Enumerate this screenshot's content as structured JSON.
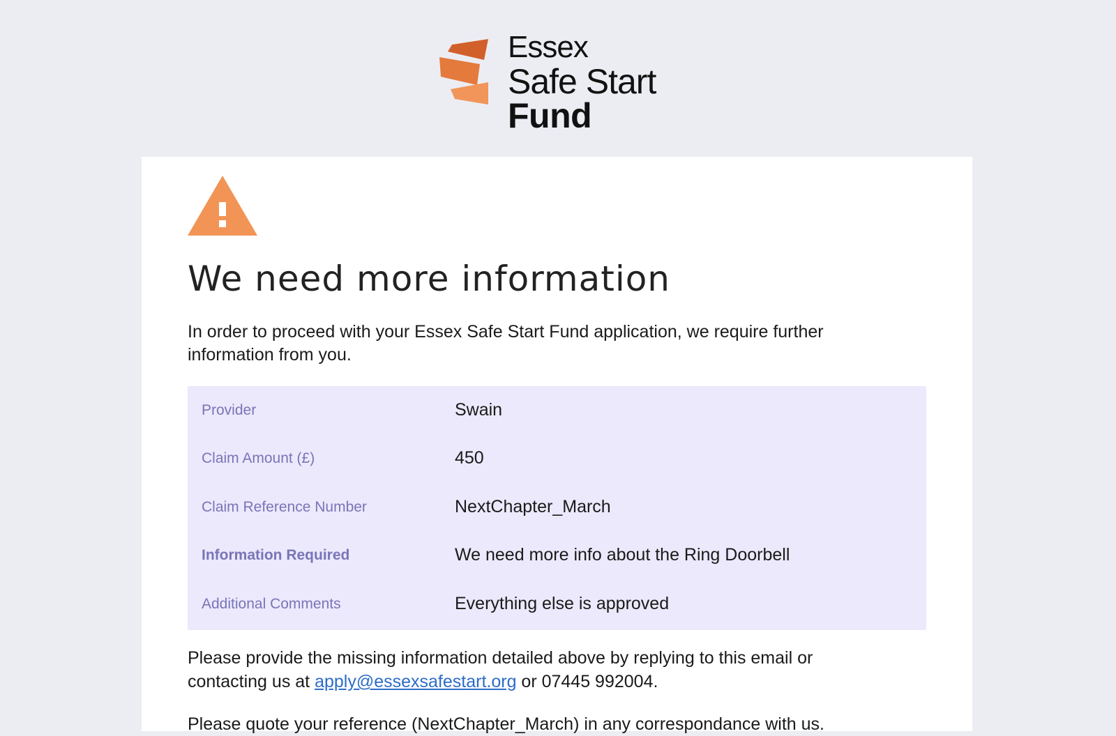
{
  "brand": {
    "line1": "Essex",
    "line2": "Safe Start",
    "line3": "Fund",
    "colors": {
      "dark_orange": "#d2602a",
      "mid_orange": "#e47a3c",
      "light_orange": "#f2955a"
    }
  },
  "alert": {
    "icon": "warning-icon",
    "icon_color": "#f29455",
    "title": "We need more information",
    "intro": "In order to proceed with your Essex Safe Start Fund application, we require further information from you."
  },
  "details": {
    "background": "#ebe9fb",
    "label_color": "#7a74b8",
    "rows": [
      {
        "label": "Provider",
        "value": "Swain"
      },
      {
        "label": "Claim Amount (£)",
        "value": "450"
      },
      {
        "label": "Claim Reference Number",
        "value": "NextChapter_March"
      },
      {
        "label": "Information Required",
        "value": "We need more info about the Ring Doorbell"
      },
      {
        "label": "Additional Comments",
        "value": "Everything else is approved"
      }
    ]
  },
  "footer": {
    "prefix": "Please provide the missing information detailed above by replying to this email or contacting us at ",
    "email_link": "apply@essexsafestart.org",
    "suffix": " or 07445 992004.",
    "quote": "Please quote your reference (NextChapter_March) in any correspondance with us."
  }
}
